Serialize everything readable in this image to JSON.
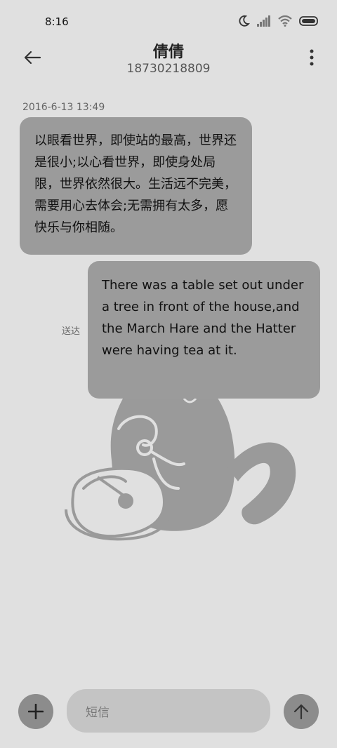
{
  "status_bar": {
    "time": "8:16",
    "icons": [
      "moon-icon",
      "signal-icon",
      "wifi-icon",
      "battery-icon"
    ]
  },
  "header": {
    "contact_name": "倩倩",
    "contact_number": "18730218809",
    "back_icon": "back-arrow-icon",
    "menu_icon": "more-vertical-icon"
  },
  "conversation": {
    "timestamp": "2016-6-13 13:49",
    "incoming_message": "以眼看世界，即使站的最高，世界还是很小;以心看世界，即使身处局限，世界依然很大。生活远不完美，需要用心去体会;无需拥有太多，愿快乐与你相随。",
    "outgoing_message": "There was a table set out under a tree in front of the house,and the March Hare and the Hatter were having tea at it.",
    "outgoing_status": "送达"
  },
  "composer": {
    "placeholder": "短信",
    "add_icon": "plus-icon",
    "send_icon": "send-arrow-up-icon"
  },
  "colors": {
    "background": "#e0e0e0",
    "bubble": "#9b9b9b",
    "input_field": "#c4c4c4",
    "round_button": "#8c8c8c"
  }
}
